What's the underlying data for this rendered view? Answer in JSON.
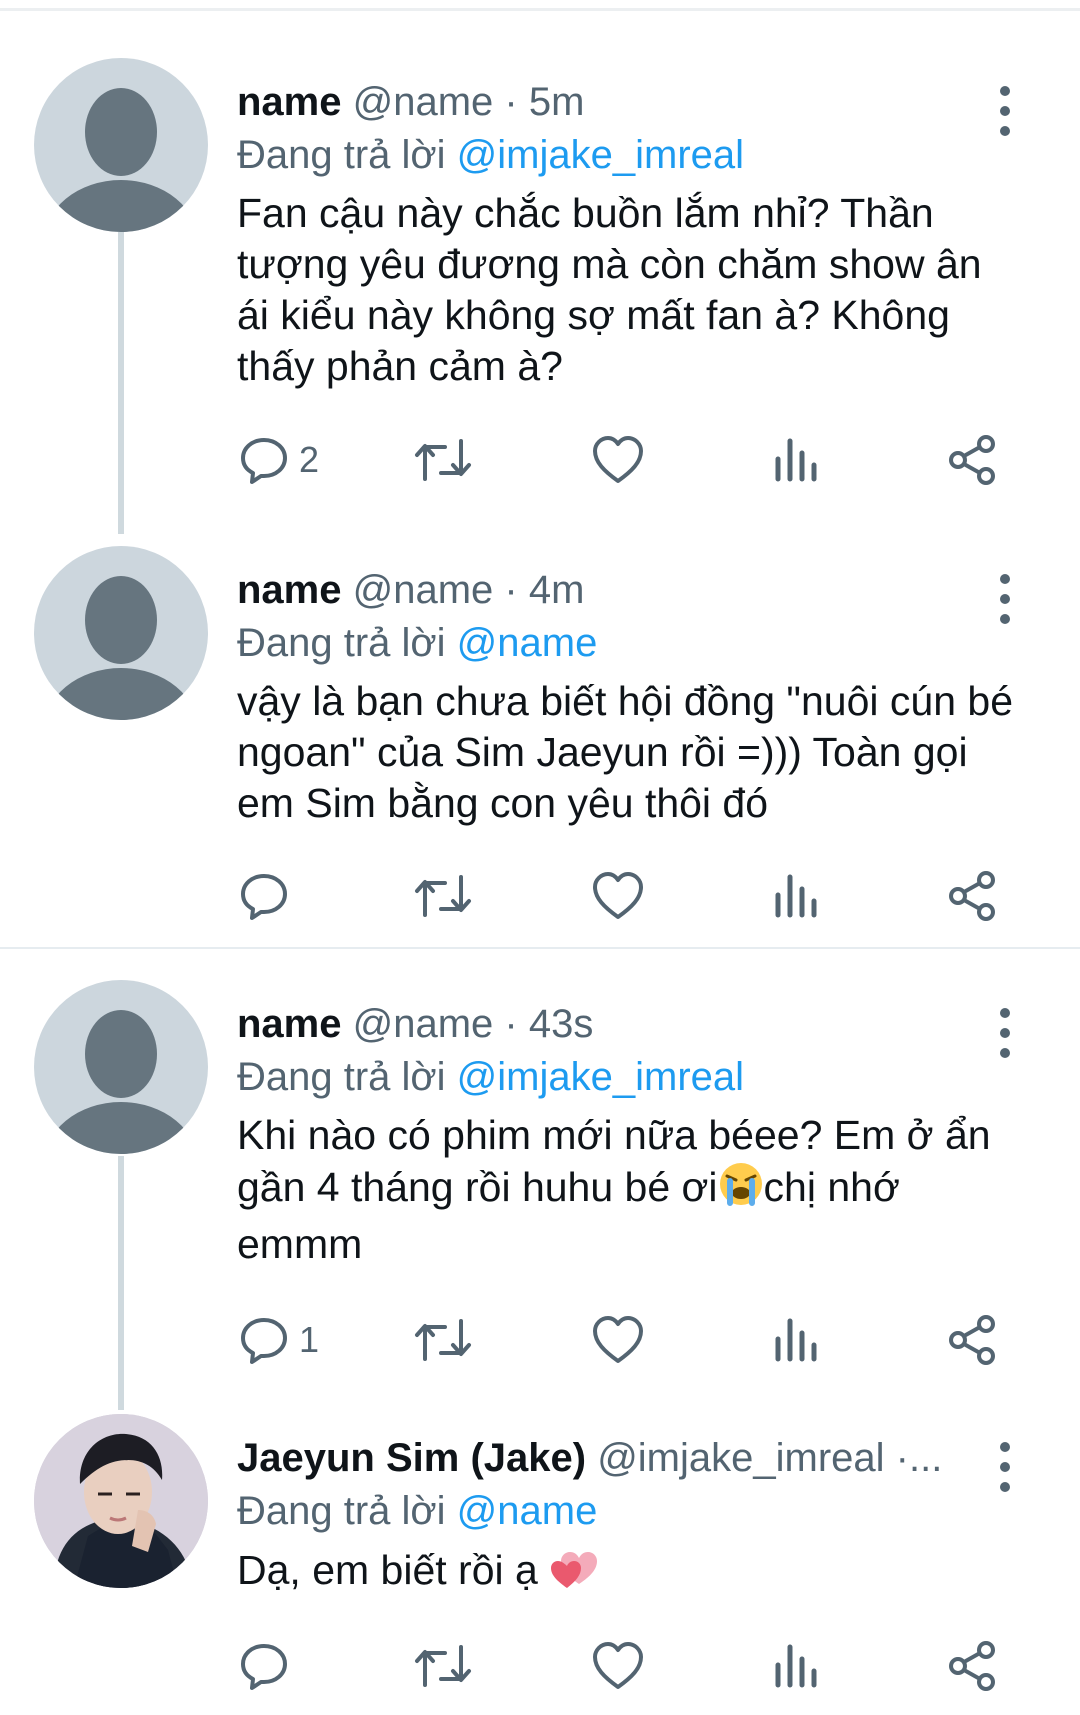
{
  "colors": {
    "text": "#0f1419",
    "secondary": "#536471",
    "link": "#1d9bf0",
    "avatar_placeholder": "#ccd6dd",
    "separator": "#e6ecf0"
  },
  "icons": {
    "reply": "reply-icon",
    "retweet": "retweet-icon",
    "like": "heart-icon",
    "views": "analytics-icon",
    "share": "share-icon",
    "more": "more-vertical-icon"
  },
  "tweets": [
    {
      "name": "name",
      "handle": "@name",
      "dot": "·",
      "time": "5m",
      "replying_prefix": "Đang trả lời",
      "replying_to": "@imjake_imreal",
      "text": "Fan cậu này chắc buồn lắm nhỉ? Thần\ntượng yêu đương mà còn chăm show ân\nái kiểu này không sợ mất fan à? Không\nthấy phản cảm à?",
      "reply_count": "2"
    },
    {
      "name": "name",
      "handle": "@name",
      "dot": "·",
      "time": "4m",
      "replying_prefix": "Đang trả lời",
      "replying_to": "@name",
      "text": "vậy là bạn chưa biết hội đồng \"nuôi cún bé\nngoan\" của Sim Jaeyun rồi =))) Toàn gọi\nem Sim bằng con yêu thôi đó",
      "reply_count": ""
    },
    {
      "name": "name",
      "handle": "@name",
      "dot": "·",
      "time": "43s",
      "replying_prefix": "Đang trả lời",
      "replying_to": "@imjake_imreal",
      "text_before_emoji": "Khi nào có phim mới nữa béee? Em ở ẩn\ngần 4 tháng rồi huhu bé ơi",
      "emoji": "loudly-crying-face-emoji",
      "text_after_emoji": "chị nhớ\nemmm",
      "reply_count": "1"
    },
    {
      "name": "Jaeyun Sim (Jake)",
      "handle": "@imjake_imreal",
      "dot": "·",
      "time": "",
      "truncation": "...",
      "replying_prefix": "Đang trả lời",
      "replying_to": "@name",
      "text": "Dạ, em biết rồi ạ ",
      "emoji": "two-hearts-emoji",
      "reply_count": ""
    }
  ]
}
